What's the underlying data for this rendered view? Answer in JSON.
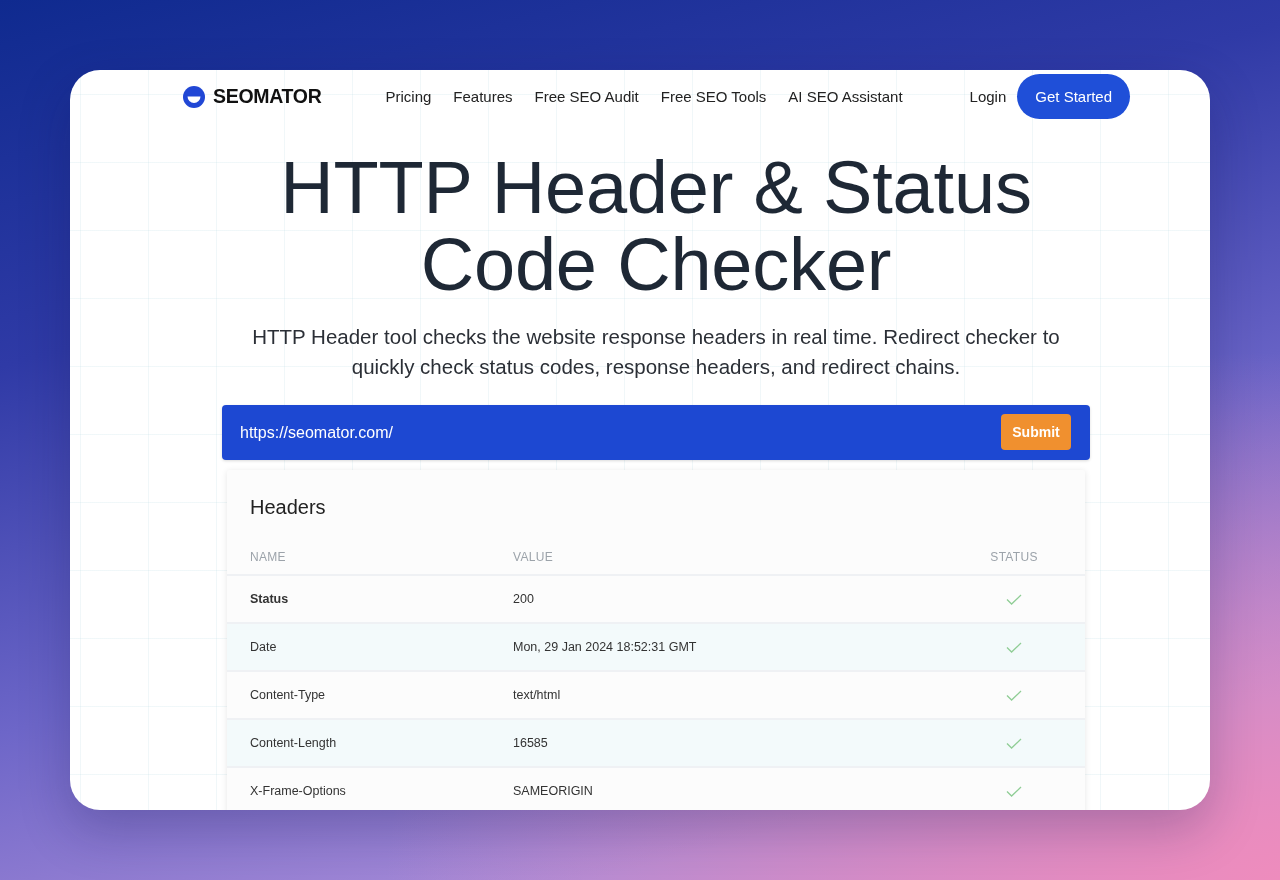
{
  "nav": {
    "brand": "SEOMATOR",
    "links": [
      "Pricing",
      "Features",
      "Free SEO Audit",
      "Free SEO Tools",
      "AI SEO Assistant"
    ],
    "login": "Login",
    "cta": "Get Started"
  },
  "hero": {
    "title": "HTTP Header & Status Code Checker",
    "subtitle": "HTTP Header tool checks the website response headers in real time. Redirect checker to quickly check status codes, response headers, and redirect chains."
  },
  "url_form": {
    "value": "https://seomator.com/",
    "button": "Submit"
  },
  "headers_table": {
    "title": "Headers",
    "columns": [
      "NAME",
      "VALUE",
      "STATUS"
    ],
    "rows": [
      {
        "kind": "status",
        "name": "Status",
        "value": "200",
        "ok": true
      },
      {
        "kind": "header",
        "name": "Date",
        "value": "Mon, 29 Jan 2024 18:52:31 GMT",
        "ok": true
      },
      {
        "kind": "header",
        "name": "Content-Type",
        "value": "text/html",
        "ok": true
      },
      {
        "kind": "header",
        "name": "Content-Length",
        "value": "16585",
        "ok": true
      },
      {
        "kind": "header",
        "name": "X-Frame-Options",
        "value": "SAMEORIGIN",
        "ok": true
      }
    ]
  }
}
